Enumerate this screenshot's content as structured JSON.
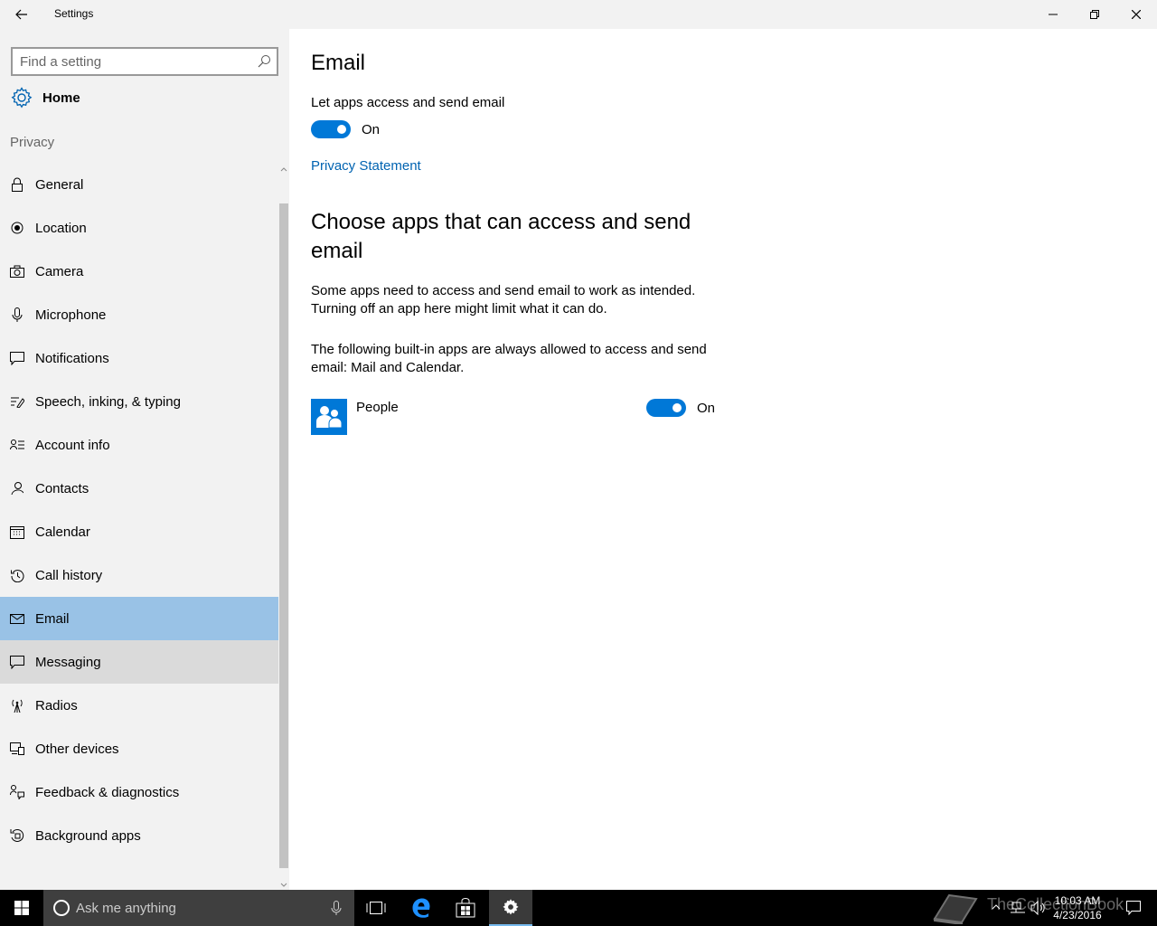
{
  "window": {
    "title": "Settings",
    "back_icon": "back-arrow-icon",
    "minimize_icon": "minimize-icon",
    "restore_icon": "restore-icon",
    "close_icon": "close-icon"
  },
  "sidebar": {
    "search_placeholder": "Find a setting",
    "home_label": "Home",
    "section_label": "Privacy",
    "items": [
      {
        "label": "General",
        "icon": "lock-icon"
      },
      {
        "label": "Location",
        "icon": "location-icon"
      },
      {
        "label": "Camera",
        "icon": "camera-icon"
      },
      {
        "label": "Microphone",
        "icon": "microphone-icon"
      },
      {
        "label": "Notifications",
        "icon": "notifications-icon"
      },
      {
        "label": "Speech, inking, & typing",
        "icon": "speech-icon"
      },
      {
        "label": "Account info",
        "icon": "account-info-icon"
      },
      {
        "label": "Contacts",
        "icon": "contacts-icon"
      },
      {
        "label": "Calendar",
        "icon": "calendar-icon"
      },
      {
        "label": "Call history",
        "icon": "call-history-icon"
      },
      {
        "label": "Email",
        "icon": "email-icon",
        "selected": true
      },
      {
        "label": "Messaging",
        "icon": "messaging-icon",
        "hover": true
      },
      {
        "label": "Radios",
        "icon": "radios-icon"
      },
      {
        "label": "Other devices",
        "icon": "other-devices-icon"
      },
      {
        "label": "Feedback & diagnostics",
        "icon": "feedback-icon"
      },
      {
        "label": "Background apps",
        "icon": "background-apps-icon"
      }
    ]
  },
  "main": {
    "title": "Email",
    "setting_label": "Let apps access and send email",
    "toggle_state": "On",
    "privacy_link": "Privacy Statement",
    "choose_heading": "Choose apps that can access and send email",
    "description1": "Some apps need to access and send email to work as intended. Turning off an app here might limit what it can do.",
    "description2": "The following built-in apps are always allowed to access and send email: Mail and Calendar.",
    "apps": [
      {
        "name": "People",
        "icon": "people-app-icon",
        "state": "On"
      }
    ]
  },
  "taskbar": {
    "cortana_placeholder": "Ask me anything",
    "watermark": "TheCollectionBook",
    "time": "10:03 AM",
    "date": "4/23/2016"
  },
  "colors": {
    "accent": "#0078d7",
    "selected_bg": "#99c2e6",
    "hover_bg": "#dadada",
    "sidebar_bg": "#f2f2f2",
    "link": "#0063b1"
  }
}
